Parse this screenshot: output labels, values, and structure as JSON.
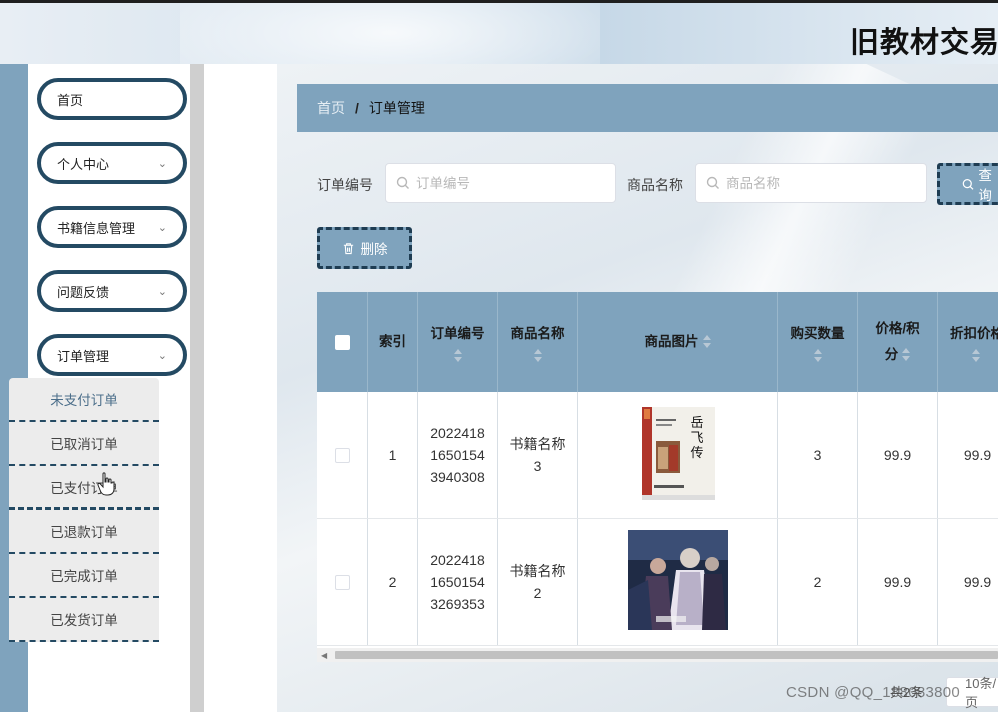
{
  "header": {
    "title": "旧教材交易系统"
  },
  "sidebar": {
    "items": [
      {
        "label": "首页",
        "has_chevron": false
      },
      {
        "label": "个人中心",
        "has_chevron": true
      },
      {
        "label": "书籍信息管理",
        "has_chevron": true
      },
      {
        "label": "问题反馈",
        "has_chevron": true
      },
      {
        "label": "订单管理",
        "has_chevron": true
      }
    ],
    "submenu": [
      {
        "label": "未支付订单"
      },
      {
        "label": "已取消订单"
      },
      {
        "label": "已支付订单"
      },
      {
        "label": "已退款订单"
      },
      {
        "label": "已完成订单"
      },
      {
        "label": "已发货订单"
      }
    ]
  },
  "breadcrumb": {
    "home": "首页",
    "separator": "/",
    "current": "订单管理"
  },
  "search": {
    "order_no_label": "订单编号",
    "order_no_placeholder": "订单编号",
    "product_name_label": "商品名称",
    "product_name_placeholder": "商品名称",
    "query_label": "查询"
  },
  "actions": {
    "delete_label": "删除"
  },
  "table": {
    "headers": {
      "index": "索引",
      "order_no": "订单编号",
      "product_name": "商品名称",
      "product_image": "商品图片",
      "quantity": "购买数量",
      "price_points_1": "价格/积",
      "price_points_2": "分",
      "discount_price": "折扣价格"
    },
    "rows": [
      {
        "index": "1",
        "order_no": [
          "2022418",
          "1650154",
          "3940308"
        ],
        "product_name": [
          "书籍名称",
          "3"
        ],
        "image": "book-cover-yuefeizhuan",
        "quantity": "3",
        "price": "99.9",
        "discount": "99.9"
      },
      {
        "index": "2",
        "order_no": [
          "2022418",
          "1650154",
          "3269353"
        ],
        "product_name": [
          "书籍名称",
          "2"
        ],
        "image": "anime-poster",
        "quantity": "2",
        "price": "99.9",
        "discount": "99.9"
      }
    ]
  },
  "pagination": {
    "total_text": "共2条",
    "page_size": "10条/页"
  },
  "watermark": "CSDN @QQ_188083800",
  "colors": {
    "accent": "#7fa3bd",
    "dark_border": "#244a63"
  }
}
